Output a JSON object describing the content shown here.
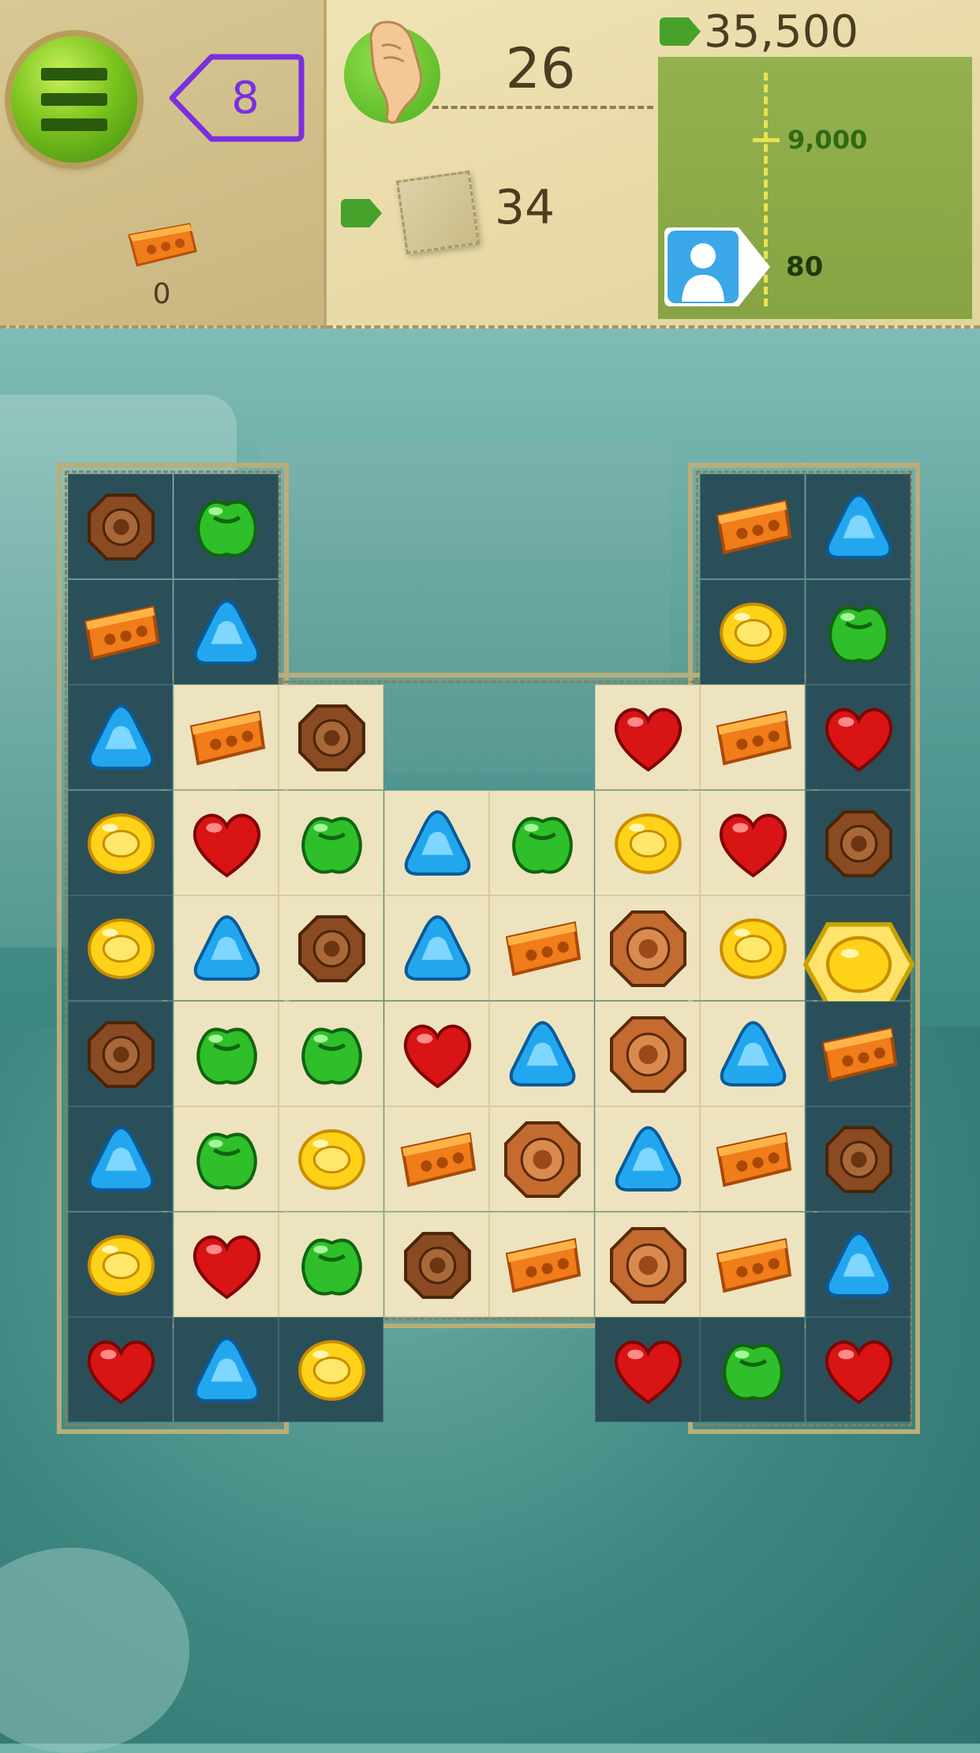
{
  "hud": {
    "moves_made": "8",
    "target_count": "0",
    "moves_left": "26",
    "tiles_left": "34",
    "score": "35,500",
    "goal": "9,000",
    "player_score": "80"
  },
  "board": {
    "rows": [
      [
        "brown",
        "green",
        null,
        null,
        null,
        null,
        "orange",
        "blue"
      ],
      [
        "orange",
        "blue",
        null,
        null,
        null,
        null,
        "yellow",
        "green"
      ],
      [
        "blue",
        "orange",
        "brown",
        null,
        null,
        "red",
        "orange",
        "red"
      ],
      [
        "yellow",
        "red",
        "green",
        "blue",
        "green",
        "yellow",
        "red",
        "brown"
      ],
      [
        "yellow",
        "blue",
        "brown",
        "blue",
        "orange",
        "bigbrown",
        "yellow",
        "yellowgem"
      ],
      [
        "brown",
        "green",
        "green",
        "red",
        "blue",
        "bigbrown",
        "blue",
        "orange"
      ],
      [
        "blue",
        "green",
        "yellow",
        "orange",
        "bigbrown",
        "blue",
        "orange",
        "brown"
      ],
      [
        "yellow",
        "red",
        "green",
        "brown",
        "orange",
        "bigbrown",
        "orange",
        "blue"
      ],
      [
        "red",
        "blue",
        "yellow",
        null,
        null,
        "red",
        "green",
        "red"
      ]
    ],
    "light_cells": [
      [
        2,
        1
      ],
      [
        2,
        2
      ],
      [
        2,
        5
      ],
      [
        2,
        6
      ],
      [
        3,
        1
      ],
      [
        3,
        2
      ],
      [
        3,
        3
      ],
      [
        3,
        4
      ],
      [
        3,
        5
      ],
      [
        3,
        6
      ],
      [
        4,
        1
      ],
      [
        4,
        2
      ],
      [
        4,
        3
      ],
      [
        4,
        4
      ],
      [
        4,
        5
      ],
      [
        4,
        6
      ],
      [
        5,
        1
      ],
      [
        5,
        2
      ],
      [
        5,
        3
      ],
      [
        5,
        4
      ],
      [
        5,
        5
      ],
      [
        5,
        6
      ],
      [
        6,
        1
      ],
      [
        6,
        2
      ],
      [
        6,
        3
      ],
      [
        6,
        4
      ],
      [
        6,
        5
      ],
      [
        6,
        6
      ],
      [
        7,
        1
      ],
      [
        7,
        2
      ],
      [
        7,
        3
      ],
      [
        7,
        4
      ],
      [
        7,
        5
      ],
      [
        7,
        6
      ]
    ]
  },
  "colors": {
    "moves_accent": "#7a2fe0",
    "hud_paper": "#e9dba7",
    "score_panel": "#8fab4a",
    "menu_green": "#7cc41e"
  }
}
